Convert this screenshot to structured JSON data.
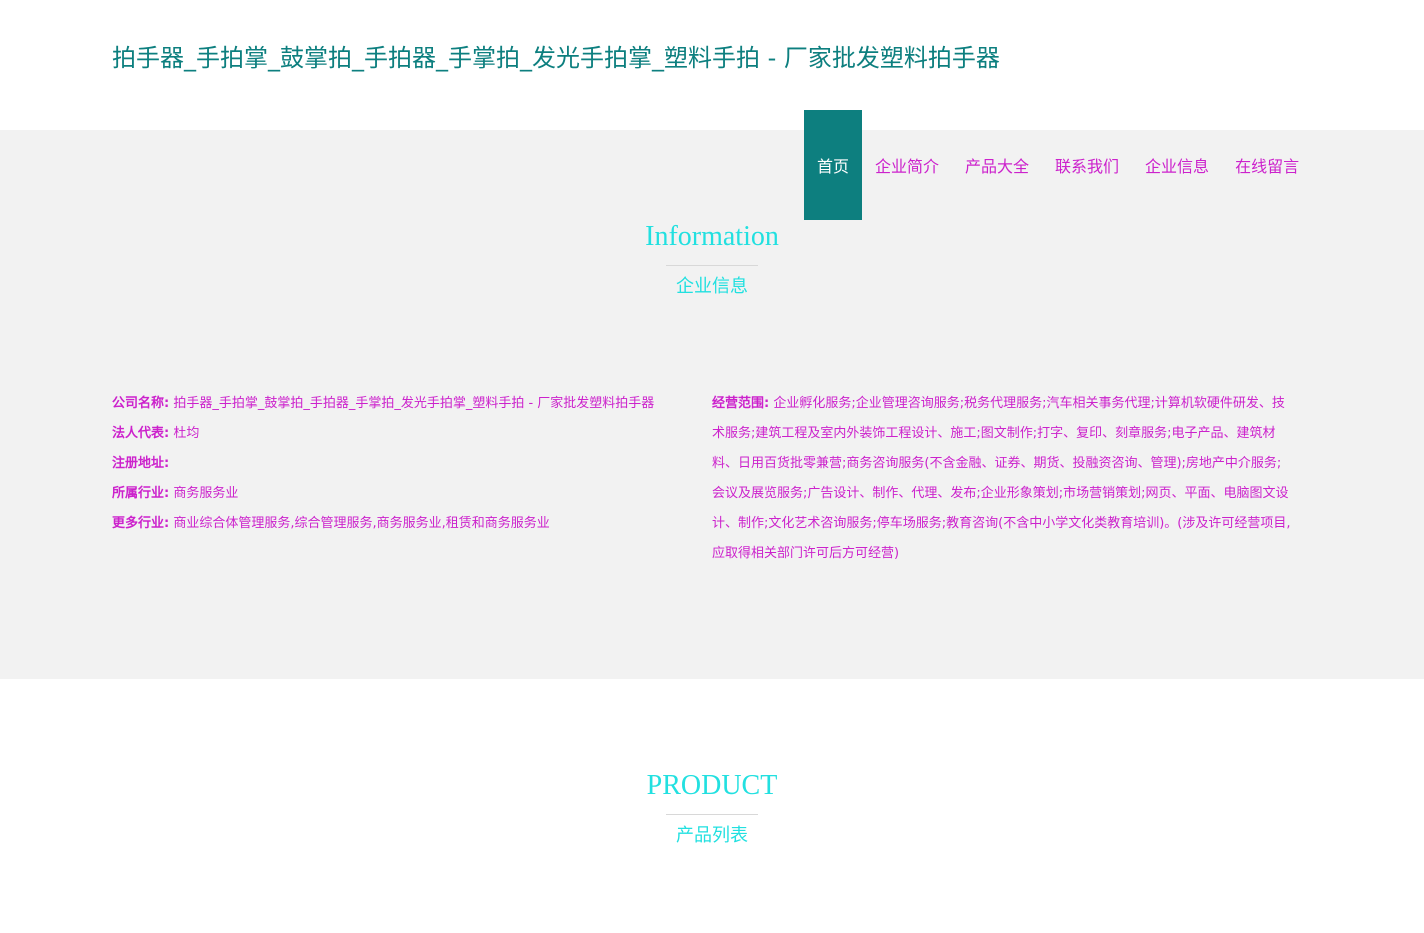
{
  "header": {
    "site_title": "拍手器_手拍掌_鼓掌拍_手拍器_手掌拍_发光手拍掌_塑料手拍 - 厂家批发塑料拍手器"
  },
  "nav": {
    "items": [
      {
        "label": "首页"
      },
      {
        "label": "企业简介"
      },
      {
        "label": "产品大全"
      },
      {
        "label": "联系我们"
      },
      {
        "label": "企业信息"
      },
      {
        "label": "在线留言"
      }
    ]
  },
  "info_section": {
    "title_en": "Information",
    "title_cn": "企业信息",
    "company_name_label": "公司名称:",
    "company_name_value": "拍手器_手拍掌_鼓掌拍_手拍器_手掌拍_发光手拍掌_塑料手拍 - 厂家批发塑料拍手器",
    "legal_rep_label": "法人代表:",
    "legal_rep_value": "杜均",
    "address_label": "注册地址:",
    "address_value": "",
    "industry_label": "所属行业:",
    "industry_value": "商务服务业",
    "more_industry_label": "更多行业:",
    "more_industry_value": "商业综合体管理服务,综合管理服务,商务服务业,租赁和商务服务业",
    "scope_label": "经营范围:",
    "scope_value": "企业孵化服务;企业管理咨询服务;税务代理服务;汽车相关事务代理;计算机软硬件研发、技术服务;建筑工程及室内外装饰工程设计、施工;图文制作;打字、复印、刻章服务;电子产品、建筑材料、日用百货批零兼营;商务咨询服务(不含金融、证券、期货、投融资咨询、管理);房地产中介服务;会议及展览服务;广告设计、制作、代理、发布;企业形象策划;市场营销策划;网页、平面、电脑图文设计、制作;文化艺术咨询服务;停车场服务;教育咨询(不含中小学文化类教育培训)。(涉及许可经营项目,应取得相关部门许可后方可经营)"
  },
  "product_section": {
    "title_en": "PRODUCT",
    "title_cn": "产品列表"
  },
  "colors": {
    "brand": "#0d7f7f",
    "accent_cyan": "#22e0e0",
    "link_magenta": "#cc22cc",
    "band_gray": "#f2f2f2"
  }
}
